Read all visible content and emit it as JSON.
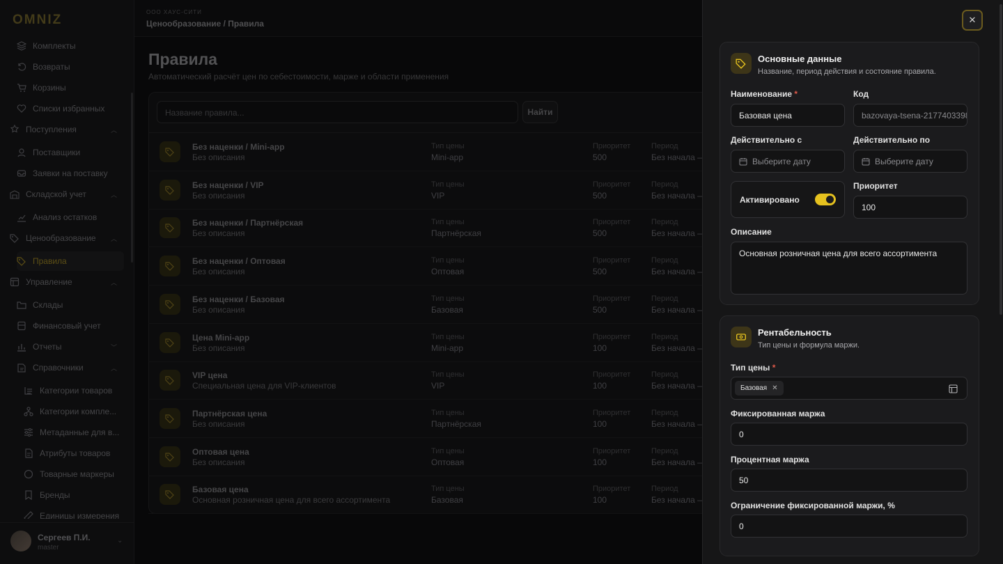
{
  "brand": "OMNIZ",
  "org": "ООО ХАУС-СИТИ",
  "breadcrumb": "Ценообразование / Правила",
  "sidebar": {
    "items": [
      {
        "label": "Комплекты",
        "icon": "layers-icon"
      },
      {
        "label": "Возвраты",
        "icon": "return-icon"
      },
      {
        "label": "Корзины",
        "icon": "cart-icon"
      },
      {
        "label": "Списки избранных",
        "icon": "heart-icon"
      },
      {
        "label": "Поступления",
        "icon": "inbox-icon"
      },
      {
        "label": "Поставщики",
        "icon": "supplier-icon"
      },
      {
        "label": "Заявки на поставку",
        "icon": "request-icon"
      },
      {
        "label": "Складской учет",
        "icon": "warehouse-icon"
      },
      {
        "label": "Анализ остатков",
        "icon": "chart-icon"
      },
      {
        "label": "Ценообразование",
        "icon": "tags-icon"
      },
      {
        "label": "Правила",
        "icon": "tag-icon"
      },
      {
        "label": "Управление",
        "icon": "layout-icon"
      },
      {
        "label": "Склады",
        "icon": "folder-icon"
      },
      {
        "label": "Финансовый учет",
        "icon": "ledger-icon"
      },
      {
        "label": "Отчеты",
        "icon": "bar-chart-icon"
      },
      {
        "label": "Справочники",
        "icon": "book-icon"
      },
      {
        "label": "Категории товаров",
        "icon": "category-icon"
      },
      {
        "label": "Категории компле...",
        "icon": "hierarchy-icon"
      },
      {
        "label": "Метаданные для в...",
        "icon": "sliders-icon"
      },
      {
        "label": "Атрибуты товаров",
        "icon": "file-icon"
      },
      {
        "label": "Товарные маркеры",
        "icon": "circle-icon"
      },
      {
        "label": "Бренды",
        "icon": "bookmark-icon"
      },
      {
        "label": "Единицы измерения",
        "icon": "ruler-icon"
      }
    ]
  },
  "user": {
    "name": "Сергеев П.И.",
    "role": "master"
  },
  "main": {
    "title": "Правила",
    "subtitle": "Автоматический расчёт цен по себестоимости, марже и области применения",
    "search_placeholder": "Название правила...",
    "find_label": "Найти",
    "col_type": "Тип цены",
    "col_priority": "Приоритет",
    "col_period": "Период",
    "rows": [
      {
        "name": "Без наценки / Mini-app",
        "desc": "Без описания",
        "type": "Mini-app",
        "priority": "500",
        "period": "Без начала —"
      },
      {
        "name": "Без наценки / VIP",
        "desc": "Без описания",
        "type": "VIP",
        "priority": "500",
        "period": "Без начала —"
      },
      {
        "name": "Без наценки / Партнёрская",
        "desc": "Без описания",
        "type": "Партнёрская",
        "priority": "500",
        "period": "Без начала —"
      },
      {
        "name": "Без наценки / Оптовая",
        "desc": "Без описания",
        "type": "Оптовая",
        "priority": "500",
        "period": "Без начала —"
      },
      {
        "name": "Без наценки / Базовая",
        "desc": "Без описания",
        "type": "Базовая",
        "priority": "500",
        "period": "Без начала —"
      },
      {
        "name": "Цена Mini-app",
        "desc": "Без описания",
        "type": "Mini-app",
        "priority": "100",
        "period": "Без начала —"
      },
      {
        "name": "VIP цена",
        "desc": "Специальная цена для VIP-клиентов",
        "type": "VIP",
        "priority": "100",
        "period": "Без начала —"
      },
      {
        "name": "Партнёрская цена",
        "desc": "Без описания",
        "type": "Партнёрская",
        "priority": "100",
        "period": "Без начала —"
      },
      {
        "name": "Оптовая цена",
        "desc": "Без описания",
        "type": "Оптовая",
        "priority": "100",
        "period": "Без начала —"
      },
      {
        "name": "Базовая цена",
        "desc": "Основная розничная цена для всего ассортимента",
        "type": "Базовая",
        "priority": "100",
        "period": "Без начала —"
      }
    ]
  },
  "drawer": {
    "basic": {
      "title": "Основные данные",
      "subtitle": "Название, период действия и состояние правила.",
      "name_label": "Наименование",
      "required_mark": "*",
      "name_value": "Базовая цена",
      "code_label": "Код",
      "code_value": "bazovaya-tsena-2177403398",
      "valid_from_label": "Действительно с",
      "valid_to_label": "Действительно по",
      "date_placeholder": "Выберите дату",
      "active_label": "Активировано",
      "active": true,
      "priority_label": "Приоритет",
      "priority_value": "100",
      "description_label": "Описание",
      "description_value": "Основная розничная цена для всего ассортимента"
    },
    "profit": {
      "title": "Рентабельность",
      "subtitle": "Тип цены и формула маржи.",
      "price_type_label": "Тип цены",
      "price_type_chip": "Базовая",
      "fixed_margin_label": "Фиксированная маржа",
      "fixed_margin_value": "0",
      "percent_margin_label": "Процентная маржа",
      "percent_margin_value": "50",
      "limit_label": "Ограничение фиксированной маржи, %",
      "limit_value": "0"
    }
  },
  "colors": {
    "accent": "#e6c21f",
    "icon_bg": "#3d3518"
  }
}
